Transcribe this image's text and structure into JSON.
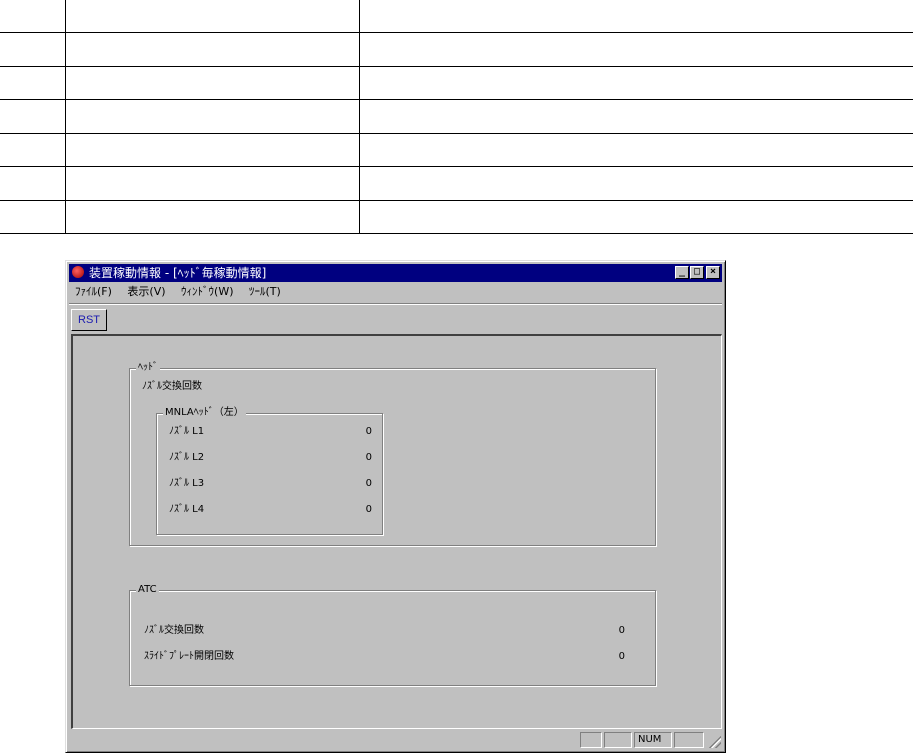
{
  "window": {
    "title": "装置稼動情報 - [ﾍｯﾄﾞ毎稼動情報]",
    "menu": [
      "ﾌｧｲﾙ(F)",
      "表示(V)",
      "ｳｨﾝﾄﾞｳ(W)",
      "ﾂｰﾙ(T)"
    ],
    "toolbar": {
      "rst_label": "RST"
    }
  },
  "head_group": {
    "legend": "ﾍｯﾄﾞ",
    "subtitle": "ﾉｽﾞﾙ交換回数",
    "sub_group": {
      "legend": "MNLAﾍｯﾄﾞ（左）",
      "rows": [
        {
          "label": "ﾉｽﾞﾙ L1",
          "value": "0"
        },
        {
          "label": "ﾉｽﾞﾙ L2",
          "value": "0"
        },
        {
          "label": "ﾉｽﾞﾙ L3",
          "value": "0"
        },
        {
          "label": "ﾉｽﾞﾙ L4",
          "value": "0"
        }
      ]
    }
  },
  "atc_group": {
    "legend": "ATC",
    "rows": [
      {
        "label": "ﾉｽﾞﾙ交換回数",
        "value": "0"
      },
      {
        "label": "ｽﾗｲﾄﾞﾌﾟﾚｰﾄ開閉回数",
        "value": "0"
      }
    ]
  },
  "statusbar": {
    "num": "NUM"
  }
}
